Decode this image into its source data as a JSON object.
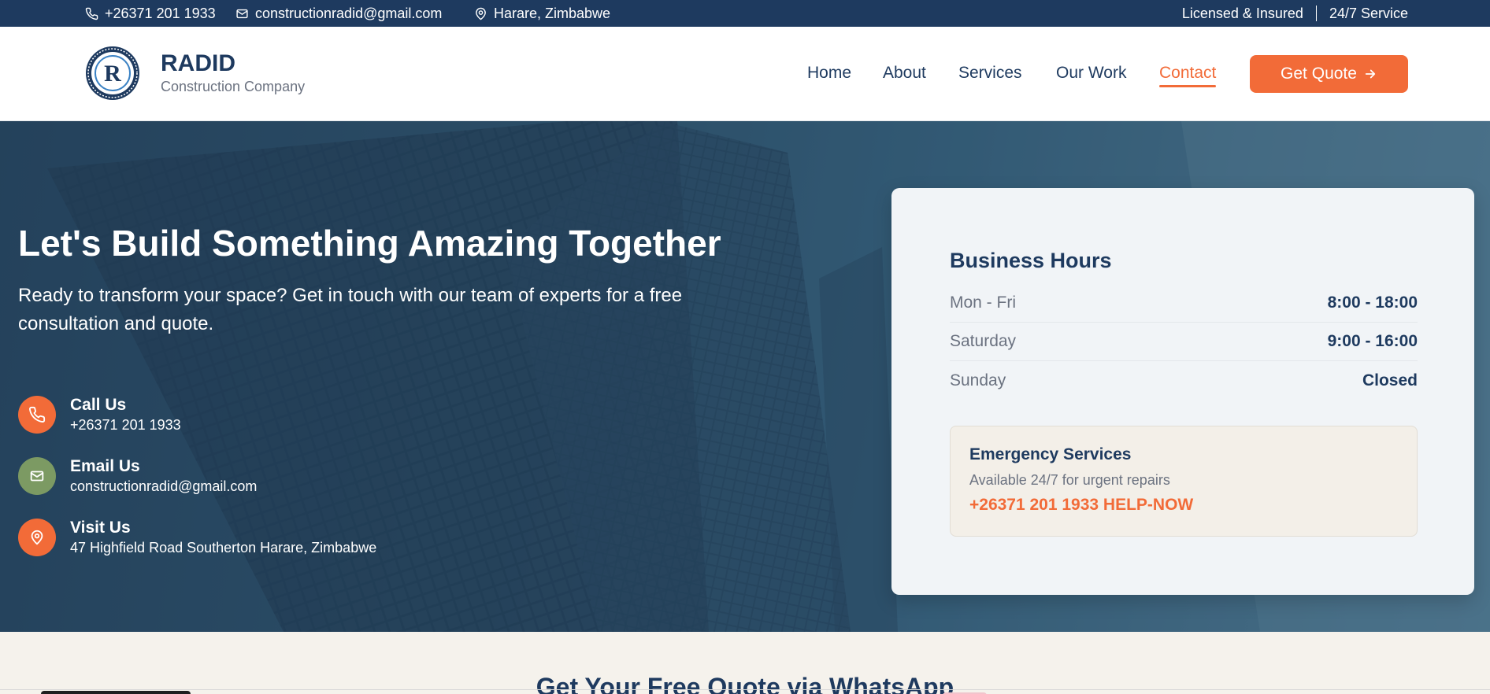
{
  "topbar": {
    "phone": "+26371 201 1933",
    "email": "constructionradid@gmail.com",
    "location": "Harare, Zimbabwe",
    "licensed": "Licensed & Insured",
    "service": "24/7 Service"
  },
  "header": {
    "brand_name": "RADID",
    "brand_sub": "Construction Company",
    "nav": [
      "Home",
      "About",
      "Services",
      "Our Work",
      "Contact"
    ],
    "active_nav": "Contact",
    "quote_button": "Get Quote"
  },
  "hero": {
    "title": "Let's Build Something Amazing Together",
    "lead": "Ready to transform your space? Get in touch with our team of experts for a free consultation and quote.",
    "contacts": [
      {
        "title": "Call Us",
        "value": "+26371 201 1933",
        "icon": "phone-icon",
        "color": "#f26b38"
      },
      {
        "title": "Email Us",
        "value": "constructionradid@gmail.com",
        "icon": "mail-icon",
        "color": "#7c9a63"
      },
      {
        "title": "Visit Us",
        "value": "47 Highfield Road Southerton Harare, Zimbabwe",
        "icon": "location-icon",
        "color": "#f26b38"
      }
    ]
  },
  "hours": {
    "title": "Business Hours",
    "rows": [
      {
        "day": "Mon - Fri",
        "hours": "8:00 - 18:00"
      },
      {
        "day": "Saturday",
        "hours": "9:00 - 16:00"
      },
      {
        "day": "Sunday",
        "hours": "Closed"
      }
    ],
    "emergency": {
      "title": "Emergency Services",
      "subtitle": "Available 24/7 for urgent repairs",
      "phone": "+26371 201 1933 HELP-NOW"
    }
  },
  "whatsapp": {
    "heading": "Get Your Free Quote via WhatsApp"
  },
  "colors": {
    "navy": "#1e3a5f",
    "accent": "#f26b38",
    "green": "#7c9a63"
  }
}
